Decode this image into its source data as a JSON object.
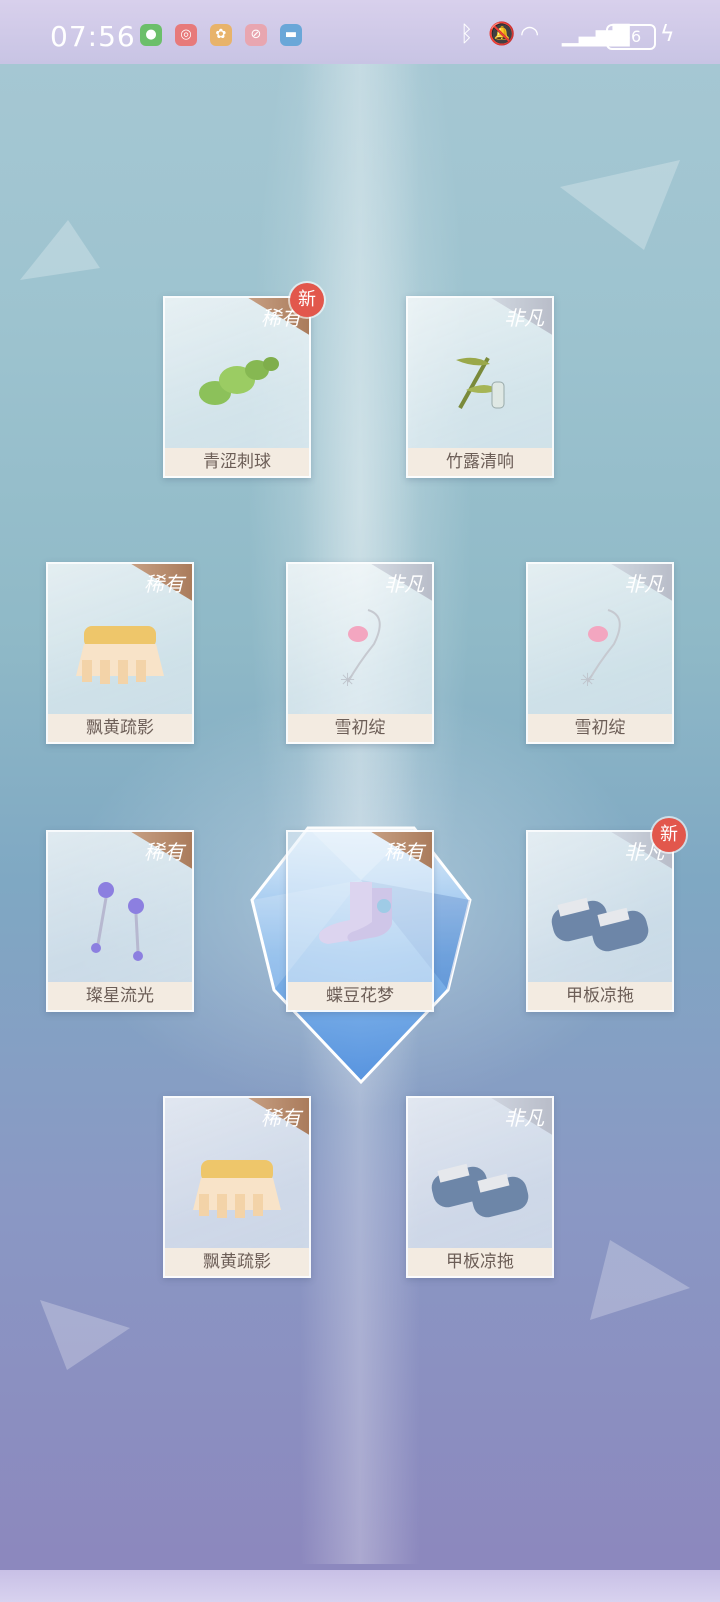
{
  "status_bar": {
    "time": "07:56",
    "battery": "56",
    "app_icons": [
      "message-icon",
      "netease-cloud-music-icon",
      "game-pet-icon",
      "pink-app-icon",
      "chat-bubble-icon"
    ]
  },
  "colors": {
    "rare_ribbon": "#b28465",
    "extraordinary_ribbon": "#b8bcc8",
    "new_badge": "#e2574c",
    "label_bg": "#f3ebe1",
    "label_text": "#6c5e57"
  },
  "rewards": [
    {
      "name": "青涩刺球",
      "rarity": "稀有",
      "is_new": true,
      "icon": "green-cactus-ball-icon"
    },
    {
      "name": "竹露清响",
      "rarity": "非凡",
      "is_new": false,
      "icon": "bamboo-dew-icon"
    },
    {
      "name": "飘黄疏影",
      "rarity": "稀有",
      "is_new": false,
      "icon": "yellow-fringe-skirt-icon"
    },
    {
      "name": "雪初绽",
      "rarity": "非凡",
      "is_new": false,
      "icon": "pink-flower-necklace-icon"
    },
    {
      "name": "雪初绽",
      "rarity": "非凡",
      "is_new": false,
      "icon": "pink-flower-necklace-icon"
    },
    {
      "name": "璨星流光",
      "rarity": "稀有",
      "is_new": false,
      "icon": "star-earrings-icon"
    },
    {
      "name": "蝶豆花梦",
      "rarity": "稀有",
      "is_new": false,
      "icon": "lavender-socks-icon"
    },
    {
      "name": "甲板凉拖",
      "rarity": "非凡",
      "is_new": true,
      "icon": "striped-sandals-icon"
    },
    {
      "name": "飘黄疏影",
      "rarity": "稀有",
      "is_new": false,
      "icon": "yellow-fringe-skirt-icon"
    },
    {
      "name": "甲板凉拖",
      "rarity": "非凡",
      "is_new": false,
      "icon": "striped-sandals-icon"
    }
  ],
  "new_badge_text": "新"
}
